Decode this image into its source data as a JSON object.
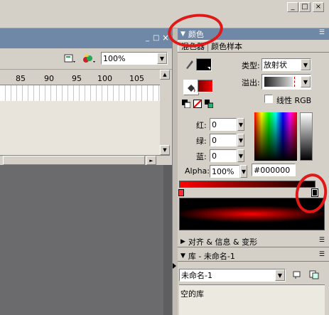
{
  "window": {
    "controls": [
      "_",
      "□",
      "×"
    ]
  },
  "stage": {
    "zoom": "100%",
    "ruler_ticks": [
      "85",
      "90",
      "95",
      "100",
      "105"
    ],
    "panel_controls": [
      "_",
      "□",
      "×"
    ]
  },
  "color_panel": {
    "title": "颜色",
    "tabs": [
      "混色器",
      "颜色样本"
    ],
    "type_label": "类型:",
    "type_value": "放射状",
    "overflow_label": "溢出:",
    "linear_rgb_label": "线性 RGB",
    "red_label": "红:",
    "red_value": "0",
    "green_label": "绿:",
    "green_value": "0",
    "blue_label": "蓝:",
    "blue_value": "0",
    "alpha_label": "Alpha:",
    "alpha_value": "100%",
    "hex_value": "#000000",
    "colors": {
      "gradient_red": "#ff0000",
      "title_bar": "#6f88a8"
    }
  },
  "align_panel": {
    "title": "对齐 & 信息 & 变形"
  },
  "library_panel": {
    "title": "库 - 未命名-1",
    "select_value": "未命名-1",
    "empty_label": "空的库"
  }
}
